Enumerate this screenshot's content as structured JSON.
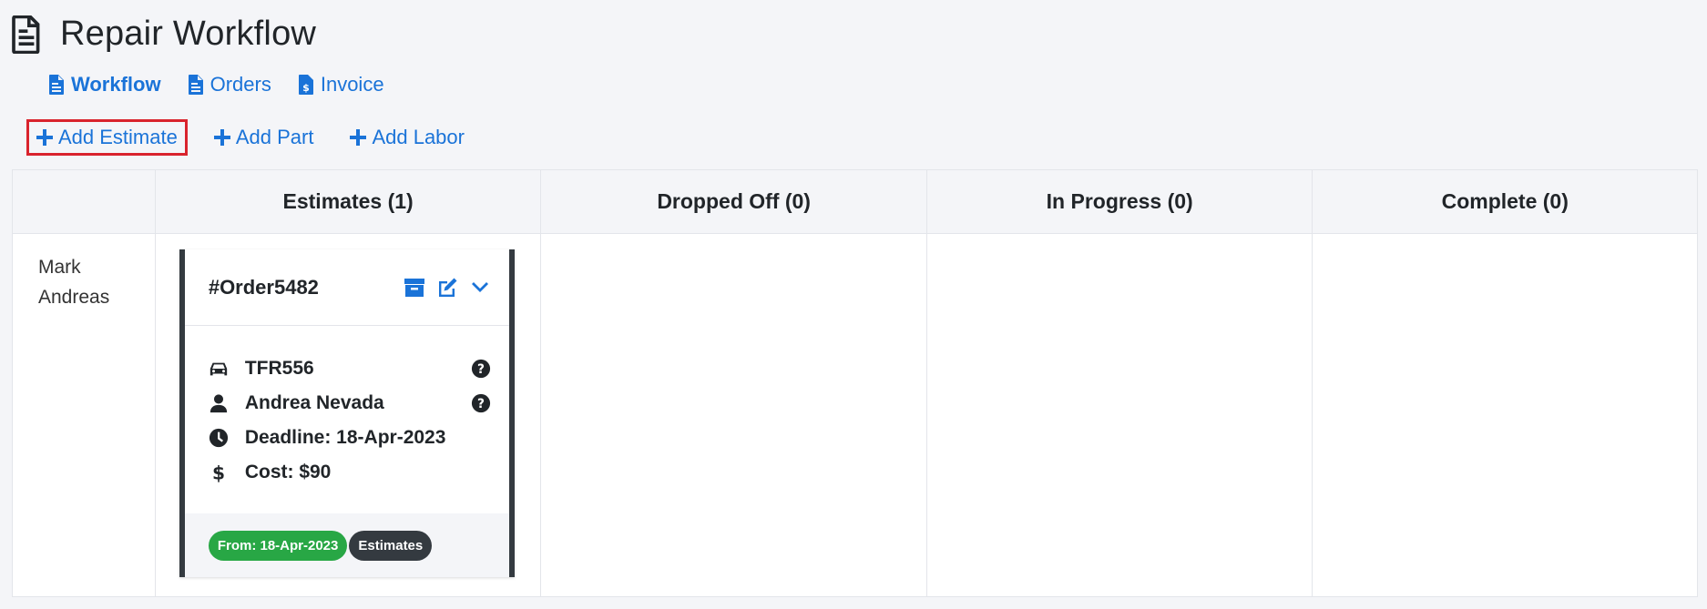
{
  "page": {
    "title": "Repair Workflow"
  },
  "nav": [
    {
      "label": "Workflow",
      "active": true
    },
    {
      "label": "Orders",
      "active": false
    },
    {
      "label": "Invoice",
      "active": false
    }
  ],
  "actions": [
    {
      "label": "Add Estimate",
      "highlighted": true
    },
    {
      "label": "Add Part",
      "highlighted": false
    },
    {
      "label": "Add Labor",
      "highlighted": false
    }
  ],
  "board": {
    "columns": [
      "Estimates (1)",
      "Dropped Off (0)",
      "In Progress (0)",
      "Complete (0)"
    ],
    "rows": [
      {
        "owner_first": "Mark",
        "owner_last": "Andreas"
      }
    ]
  },
  "card": {
    "order_id": "#Order5482",
    "plate": "TFR556",
    "customer": "Andrea Nevada",
    "deadline": "Deadline: 18-Apr-2023",
    "cost": "Cost: $90",
    "from_badge": "From: 18-Apr-2023",
    "status_badge": "Estimates"
  },
  "colors": {
    "accent": "#1a73d8",
    "highlight": "#d9232d",
    "badge_green": "#28a745",
    "badge_dark": "#343a40"
  },
  "icons": {
    "title": "file-invoice-icon",
    "card_tools": [
      "archive-icon",
      "edit-icon",
      "chevron-down-icon"
    ],
    "rows": [
      "car-icon",
      "user-icon",
      "clock-icon",
      "dollar-icon"
    ],
    "help": "question-circle-icon"
  }
}
